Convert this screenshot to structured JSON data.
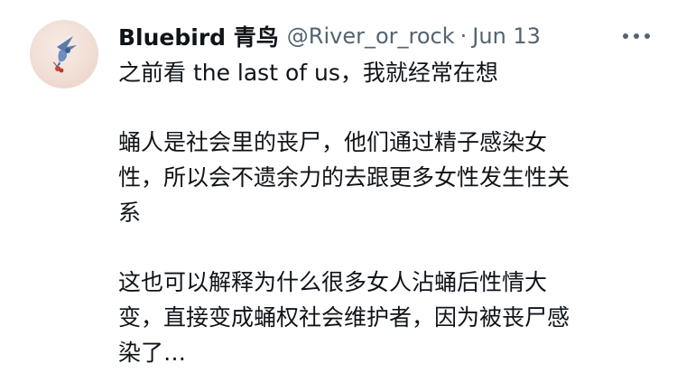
{
  "tweet": {
    "author": {
      "display_name": "Bluebird 青鸟",
      "handle": "@River_or_rock",
      "separator": "·",
      "date": "Jun 13",
      "avatar_icon": "bird-avatar"
    },
    "more_icon": "more-options-icon",
    "text": {
      "paragraph1_line1": "之前看 the last of us，我就经常在想",
      "paragraph2_line1": "蛹人是社会里的丧尸，他们通过精子感染女",
      "paragraph2_line2": "性，所以会不遗余力的去跟更多女性发生性关",
      "paragraph2_line3": "系",
      "paragraph3_line1": "这也可以解释为什么很多女人沾蛹后性情大",
      "paragraph3_line2": "变，直接变成蛹权社会维护者，因为被丧尸感",
      "paragraph3_line3": "染了…"
    }
  },
  "colors": {
    "primary_text": "#0f1419",
    "secondary_text": "#536471",
    "background": "#ffffff"
  }
}
